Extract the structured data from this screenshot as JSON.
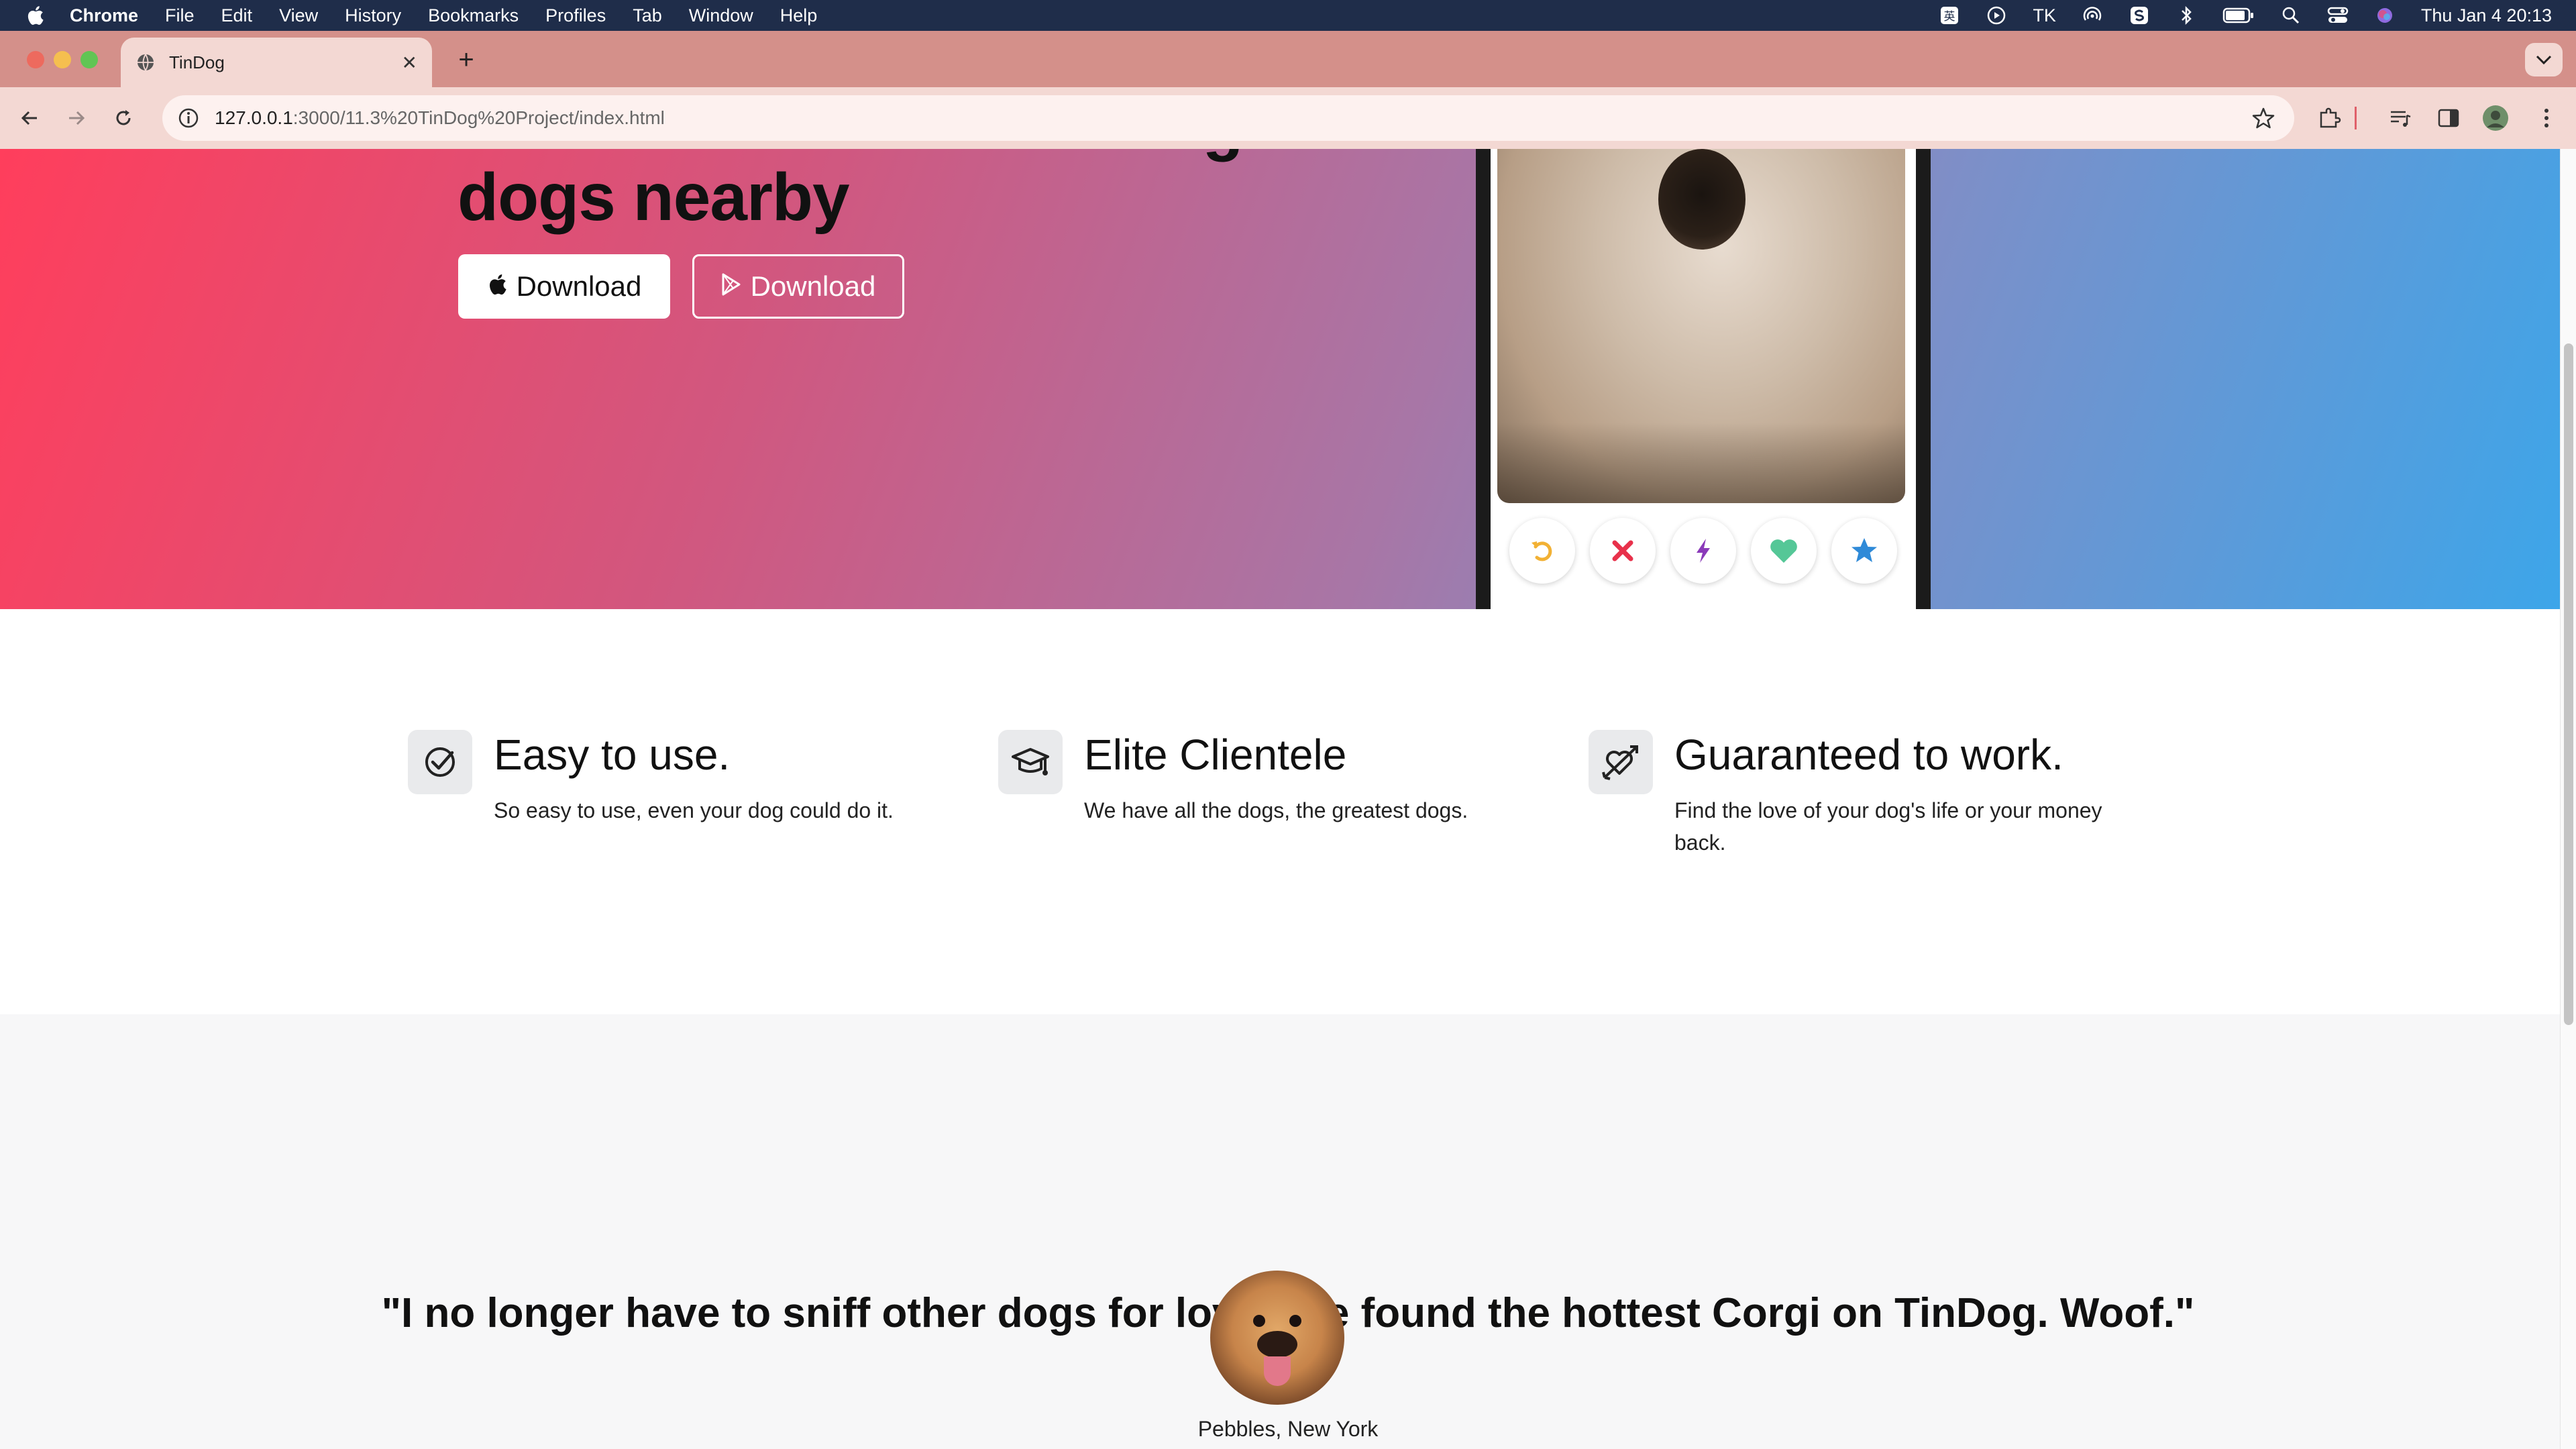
{
  "menubar": {
    "app": "Chrome",
    "items": [
      "File",
      "Edit",
      "View",
      "History",
      "Bookmarks",
      "Profiles",
      "Tab",
      "Window",
      "Help"
    ],
    "status_text": "TK",
    "clock": "Thu Jan 4  20:13"
  },
  "browser": {
    "tab_title": "TinDog",
    "url_host": "127.0.0.1",
    "url_rest": ":3000/11.3%20TinDog%20Project/index.html"
  },
  "hero": {
    "title": "Meet new and interesting dogs nearby",
    "apple_button": "Download",
    "play_button": "Download"
  },
  "features": [
    {
      "title": "Easy to use.",
      "description": "So easy to use, even your dog could do it.",
      "icon": "check-circle-icon"
    },
    {
      "title": "Elite Clientele",
      "description": "We have all the dogs, the greatest dogs.",
      "icon": "graduation-cap-icon"
    },
    {
      "title": "Guaranteed to work.",
      "description": "Find the love of your dog's life or your money back.",
      "icon": "heart-arrow-icon"
    }
  ],
  "testimonial": {
    "quote": "\"I no longer have to sniff other dogs for love. I've found the hottest Corgi on TinDog. Woof.\"",
    "author": "Pebbles, New York"
  },
  "colors": {
    "hero_start": "#ff3e5c",
    "hero_end": "#3ba6ea",
    "menubar": "#1f2d4a",
    "tabstrip": "#d4908a"
  }
}
